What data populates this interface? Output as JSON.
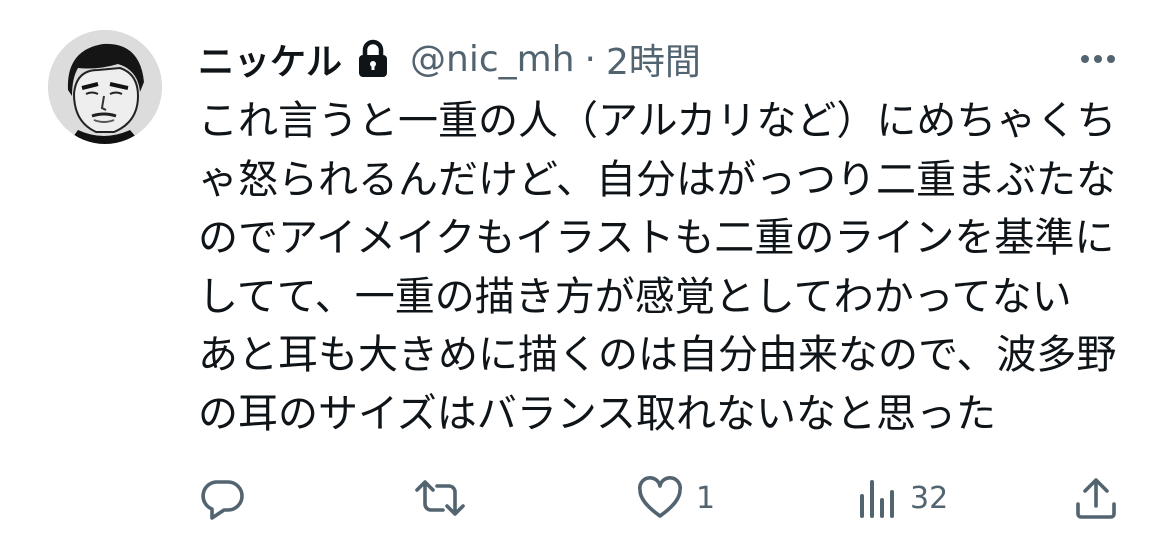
{
  "tweet": {
    "display_name": "ニッケル",
    "handle": "@nic_mh",
    "separator": "·",
    "time": "2時間",
    "text_lines": [
      "これ言うと一重の人（アルカリなど）にめちゃくち",
      "ゃ怒られるんだけど、自分はがっつり二重まぶたな",
      "のでアイメイクもイラストも二重のラインを基準に",
      "してて、一重の描き方が感覚としてわかってない",
      "あと耳も大きめに描くのは自分由来なので、波多野",
      "の耳のサイズはバランス取れないなと思った"
    ]
  },
  "actions": {
    "reply_count": "",
    "retweet_count": "",
    "like_count": "1",
    "views_count": "32"
  },
  "icons": {
    "lock": "lock-icon",
    "more": "more-icon",
    "reply": "reply-icon",
    "retweet": "retweet-icon",
    "like": "heart-icon",
    "views": "views-icon",
    "share": "share-icon"
  },
  "colors": {
    "text": "#0f1419",
    "secondary": "#536471",
    "background": "#ffffff"
  }
}
